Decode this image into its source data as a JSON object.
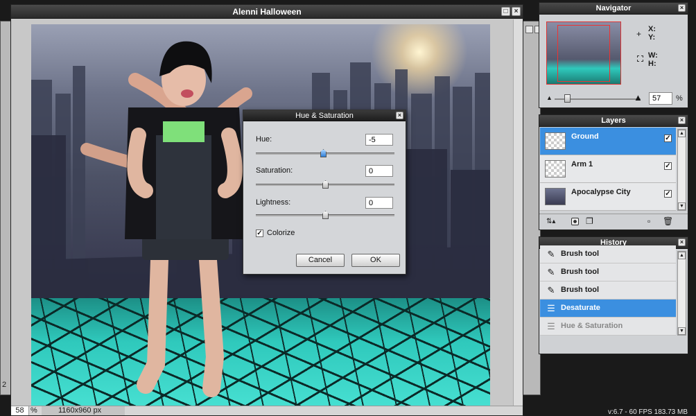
{
  "document": {
    "title": "Alenni Halloween",
    "zoom": "58",
    "zoom_unit": "%",
    "dimensions": "1160x960 px"
  },
  "background_window": {
    "left_text": "2"
  },
  "dialog": {
    "title": "Hue & Saturation",
    "hue_label": "Hue:",
    "hue_value": "-5",
    "saturation_label": "Saturation:",
    "saturation_value": "0",
    "lightness_label": "Lightness:",
    "lightness_value": "0",
    "colorize_label": "Colorize",
    "colorize_checked": true,
    "cancel_label": "Cancel",
    "ok_label": "OK"
  },
  "navigator": {
    "title": "Navigator",
    "x_label": "X:",
    "y_label": "Y:",
    "w_label": "W:",
    "h_label": "H:",
    "zoom_value": "57",
    "zoom_unit": "%"
  },
  "layers": {
    "title": "Layers",
    "items": [
      {
        "name": "Ground",
        "selected": true,
        "visible": true
      },
      {
        "name": "Arm 1",
        "selected": false,
        "visible": true
      },
      {
        "name": "Apocalypse City",
        "selected": false,
        "visible": true
      }
    ]
  },
  "history": {
    "title": "History",
    "items": [
      {
        "name": "Brush tool",
        "icon": "brush-icon"
      },
      {
        "name": "Brush tool",
        "icon": "brush-icon"
      },
      {
        "name": "Brush tool",
        "icon": "brush-icon"
      },
      {
        "name": "Desaturate",
        "icon": "adjust-icon",
        "selected": true
      },
      {
        "name": "Hue & Saturation",
        "icon": "adjust-icon",
        "dimmed": true
      }
    ]
  },
  "status": {
    "perf": "v:6.7 - 60 FPS 183.73 MB"
  },
  "colors": {
    "selection": "#3b8fe0",
    "ground_teal": "#2fc9bc"
  }
}
